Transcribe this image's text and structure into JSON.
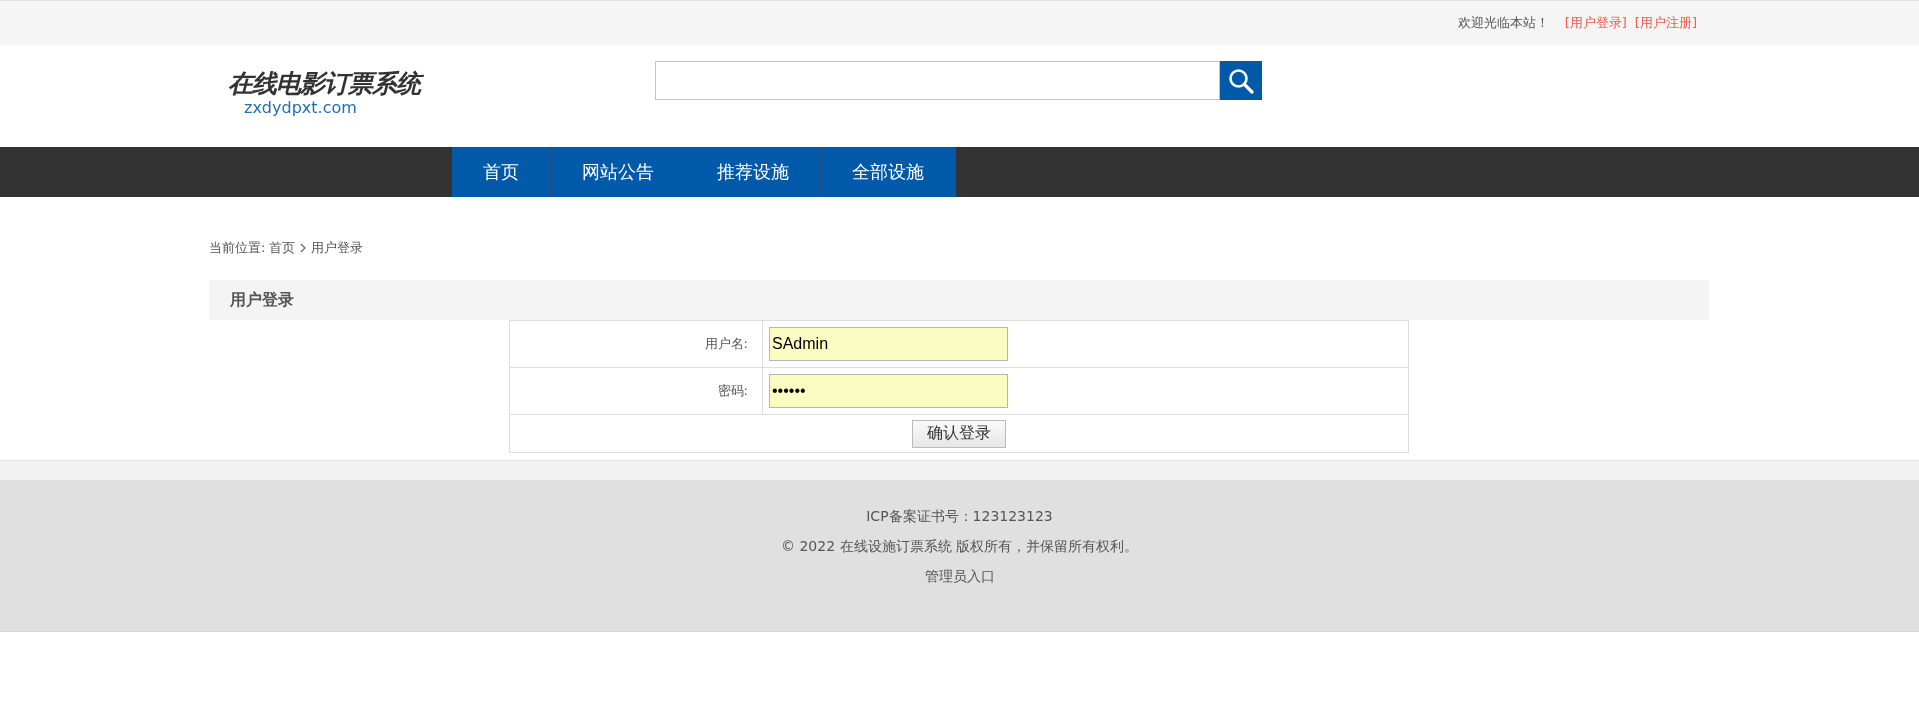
{
  "top_bar": {
    "welcome": "欢迎光临本站！",
    "links": [
      "[用户登录]",
      "[用户注册]"
    ]
  },
  "logo": {
    "title": "在线电影订票系统",
    "domain": "zxdydpxt.com"
  },
  "nav": [
    "首页",
    "网站公告",
    "推荐设施",
    "全部设施"
  ],
  "breadcrumb": {
    "prefix": "当前位置:",
    "items": [
      "首页",
      "用户登录"
    ]
  },
  "login": {
    "title": "用户登录",
    "fields": [
      {
        "label": "用户名:",
        "value": "SAdmin"
      },
      {
        "label": "密码:",
        "value": "••••••"
      }
    ],
    "submit": "确认登录"
  },
  "footer": {
    "icp": "ICP备案证书号：123123123",
    "copyright": "© 2022 在线设施订票系统 版权所有，并保留所有权利。",
    "admin_link": "管理员入口"
  }
}
